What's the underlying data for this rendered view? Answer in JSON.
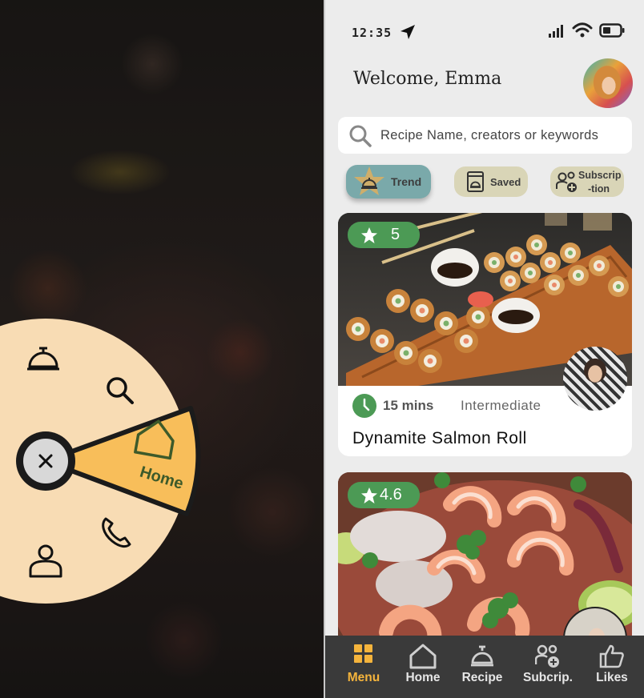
{
  "colors": {
    "accent": "#f5b43c",
    "menu_wheel": "#f8dcb4",
    "home_wedge": "#f8be5a",
    "rating_green": "#4c9a55",
    "trend_chip": "#7aa9aa",
    "chip_neutral": "#d9d5b7",
    "nav_bg": "#3a3a3a"
  },
  "radial_menu": {
    "items": [
      {
        "name": "recipe",
        "icon": "cloche-icon"
      },
      {
        "name": "search",
        "icon": "search-icon"
      },
      {
        "name": "home",
        "icon": "home-icon",
        "label": "Home",
        "active": true
      },
      {
        "name": "phone",
        "icon": "phone-icon"
      },
      {
        "name": "profile",
        "icon": "user-icon"
      }
    ],
    "close_icon": "close-icon",
    "home_label": "Home"
  },
  "status_bar": {
    "time": "12:35",
    "icons": [
      "location-arrow-icon",
      "signal-icon",
      "wifi-icon",
      "battery-icon"
    ]
  },
  "header": {
    "welcome": "Welcome, Emma",
    "avatar": "user-avatar"
  },
  "search": {
    "placeholder": "Recipe Name, creators or keywords"
  },
  "chips": {
    "trend": "Trend",
    "saved": "Saved",
    "subscription_line1": "Subscrip",
    "subscription_line2": "-tion"
  },
  "recipes": [
    {
      "rating": "5",
      "duration": "15 mins",
      "difficulty": "Intermediate",
      "title": "Dynamite Salmon Roll"
    },
    {
      "rating": "4.6"
    }
  ],
  "bottom_nav": [
    {
      "label": "Menu",
      "icon": "grid-icon",
      "active": true
    },
    {
      "label": "Home",
      "icon": "home-icon"
    },
    {
      "label": "Recipe",
      "icon": "cloche-icon"
    },
    {
      "label": "Subcrip.",
      "icon": "add-user-icon"
    },
    {
      "label": "Likes",
      "icon": "thumbs-up-icon"
    }
  ]
}
